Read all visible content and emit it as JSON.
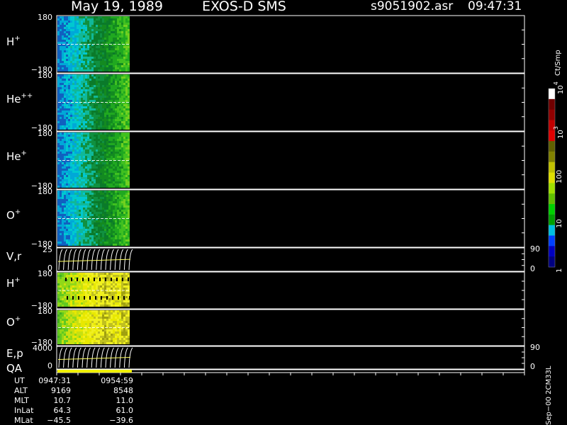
{
  "header": {
    "date": "May 19, 1989",
    "instrument": "EXOS-D SMS",
    "file": "s9051902.asr",
    "time": "09:47:31"
  },
  "panels": [
    {
      "id": "h_plus",
      "label": "H",
      "sup": "+",
      "top_tick": "180",
      "bottom_tick": "−180"
    },
    {
      "id": "he_pp",
      "label": "He",
      "sup": "++",
      "top_tick": "180",
      "bottom_tick": "−180"
    },
    {
      "id": "he_plus",
      "label": "He",
      "sup": "+",
      "top_tick": "180",
      "bottom_tick": "−180"
    },
    {
      "id": "o_plus",
      "label": "O",
      "sup": "+",
      "top_tick": "180",
      "bottom_tick": "−180"
    },
    {
      "id": "vr",
      "label": "V,r",
      "sup": "",
      "top_tick": "25",
      "bottom_tick": "0",
      "right_top": "90",
      "right_bottom": "0"
    },
    {
      "id": "h_plus_2",
      "label": "H",
      "sup": "+",
      "top_tick": "180",
      "bottom_tick": "−180"
    },
    {
      "id": "o_plus_2",
      "label": "O",
      "sup": "+",
      "top_tick": "180",
      "bottom_tick": "−180"
    },
    {
      "id": "ep",
      "label": "E,p",
      "sup": "",
      "top_tick": "4000",
      "bottom_tick": "0",
      "right_top": "90",
      "right_bottom": "0"
    }
  ],
  "qa_label": "QA",
  "colorbar": {
    "unit": "Ct/Smp",
    "labels": [
      {
        "text": "1",
        "v": 1
      },
      {
        "text": "10",
        "v": 10
      },
      {
        "text": "100",
        "v": 100
      },
      {
        "text": "10",
        "sup": "3",
        "v": 1000
      },
      {
        "text": "10",
        "sup": "4",
        "v": 10000
      }
    ],
    "colors": [
      "#000080",
      "#0000c0",
      "#0040ff",
      "#00c0e0",
      "#00a000",
      "#00d000",
      "#60c000",
      "#a0e000",
      "#e0e000",
      "#c0c000",
      "#808000",
      "#606000",
      "#e00000",
      "#c00000",
      "#900000",
      "#700000",
      "#ffffff"
    ]
  },
  "orbit_table": {
    "rows": [
      {
        "label": "UT",
        "start": "0947:31",
        "end": "0954:59"
      },
      {
        "label": "ALT",
        "start": "9169",
        "end": "8548"
      },
      {
        "label": "MLT",
        "start": "10.7",
        "end": "11.0"
      },
      {
        "label": "InLat",
        "start": "64.3",
        "end": "61.0"
      },
      {
        "label": "MLat",
        "start": "−45.5",
        "end": "−39.6"
      }
    ]
  },
  "footer_note": "Sep−00 2CM33L",
  "chart_data": {
    "type": "heatmap",
    "x_range_ut": [
      "0947:31",
      "0954:59"
    ],
    "y_range_pitch_angle": [
      -180,
      180
    ],
    "color_scale": "log",
    "color_range": [
      1,
      10000
    ],
    "zlabel": "Ct/Smp"
  }
}
